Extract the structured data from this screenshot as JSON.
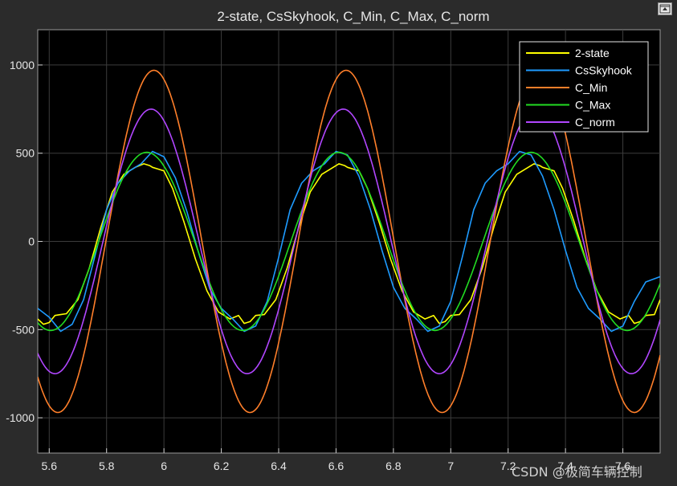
{
  "window": {
    "restore_icon": "restore-window-icon",
    "watermark": "CSDN @极简车辆控制"
  },
  "chart_data": {
    "type": "line",
    "title": "2-state, CsSkyhook, C_Min, C_Max, C_norm",
    "xlabel": "",
    "ylabel": "",
    "xlim": [
      5.56,
      7.73
    ],
    "ylim": [
      -1200,
      1200
    ],
    "x_ticks": [
      5.6,
      5.8,
      6,
      6.2,
      6.4,
      6.6,
      6.8,
      7,
      7.2,
      7.4,
      7.6
    ],
    "x_tick_labels": [
      "5.6",
      "5.8",
      "6",
      "6.2",
      "6.4",
      "6.6",
      "6.8",
      "7",
      "7.2",
      "7.4",
      "7.6"
    ],
    "y_ticks": [
      -1000,
      -500,
      0,
      500,
      1000
    ],
    "y_tick_labels": [
      "-1000",
      "-500",
      "0",
      "500",
      "1000"
    ],
    "grid": true,
    "legend_position": "top-right",
    "background": "#000000",
    "axes_color": "#ffffff",
    "title_color": "#e6e6e6",
    "series": [
      {
        "name": "2-state",
        "color": "#ffff00",
        "x": [
          5.56,
          5.58,
          5.6,
          5.62,
          5.64,
          5.66,
          5.7,
          5.74,
          5.78,
          5.82,
          5.86,
          5.9,
          5.93,
          5.95,
          5.96,
          5.98,
          6.0,
          6.03,
          6.07,
          6.11,
          6.15,
          6.19,
          6.23,
          6.26,
          6.28,
          6.3,
          6.32,
          6.35,
          6.39,
          6.43,
          6.47,
          6.51,
          6.55,
          6.59,
          6.61,
          6.63,
          6.64,
          6.66,
          6.68,
          6.71,
          6.75,
          6.79,
          6.83,
          6.87,
          6.91,
          6.94,
          6.96,
          6.98,
          7.0,
          7.03,
          7.07,
          7.11,
          7.15,
          7.19,
          7.23,
          7.27,
          7.29,
          7.31,
          7.32,
          7.34,
          7.36,
          7.39,
          7.43,
          7.47,
          7.51,
          7.55,
          7.59,
          7.62,
          7.64,
          7.66,
          7.68,
          7.71,
          7.73
        ],
        "y": [
          -440,
          -470,
          -460,
          -420,
          -415,
          -410,
          -330,
          -150,
          80,
          280,
          380,
          420,
          440,
          430,
          420,
          410,
          400,
          300,
          110,
          -100,
          -280,
          -400,
          -440,
          -420,
          -465,
          -455,
          -420,
          -415,
          -330,
          -150,
          80,
          280,
          380,
          420,
          440,
          430,
          420,
          410,
          400,
          300,
          110,
          -100,
          -280,
          -400,
          -440,
          -420,
          -465,
          -455,
          -420,
          -415,
          -330,
          -150,
          80,
          280,
          380,
          420,
          440,
          430,
          420,
          410,
          400,
          300,
          110,
          -100,
          -280,
          -400,
          -440,
          -420,
          -465,
          -455,
          -420,
          -415,
          -330
        ]
      },
      {
        "name": "CsSkyhook",
        "color": "#1e9bff",
        "x": [
          5.56,
          5.6,
          5.64,
          5.68,
          5.72,
          5.76,
          5.8,
          5.84,
          5.88,
          5.92,
          5.96,
          6.0,
          6.04,
          6.08,
          6.12,
          6.16,
          6.2,
          6.24,
          6.28,
          6.32,
          6.36,
          6.4,
          6.44,
          6.48,
          6.52,
          6.56,
          6.6,
          6.64,
          6.68,
          6.72,
          6.76,
          6.8,
          6.84,
          6.88,
          6.92,
          6.96,
          7.0,
          7.04,
          7.08,
          7.12,
          7.16,
          7.2,
          7.24,
          7.28,
          7.32,
          7.36,
          7.4,
          7.44,
          7.48,
          7.52,
          7.56,
          7.6,
          7.64,
          7.68,
          7.73
        ],
        "y": [
          -380,
          -430,
          -510,
          -470,
          -330,
          -80,
          180,
          330,
          400,
          440,
          510,
          480,
          360,
          170,
          -60,
          -270,
          -380,
          -440,
          -510,
          -480,
          -340,
          -90,
          180,
          330,
          400,
          440,
          510,
          490,
          370,
          180,
          -50,
          -260,
          -380,
          -440,
          -510,
          -480,
          -340,
          -90,
          180,
          330,
          400,
          440,
          510,
          490,
          370,
          180,
          -50,
          -260,
          -380,
          -440,
          -510,
          -480,
          -340,
          -230,
          -200
        ]
      },
      {
        "name": "C_Min",
        "color": "#ff7f2a",
        "amplitude": 970,
        "period": 0.67,
        "peak_x": 5.965
      },
      {
        "name": "C_Max",
        "color": "#22dd22",
        "amplitude": 505,
        "period": 0.67,
        "peak_x": 5.94
      },
      {
        "name": "C_norm",
        "color": "#b146ff",
        "amplitude": 750,
        "period": 0.67,
        "peak_x": 5.955
      }
    ]
  }
}
